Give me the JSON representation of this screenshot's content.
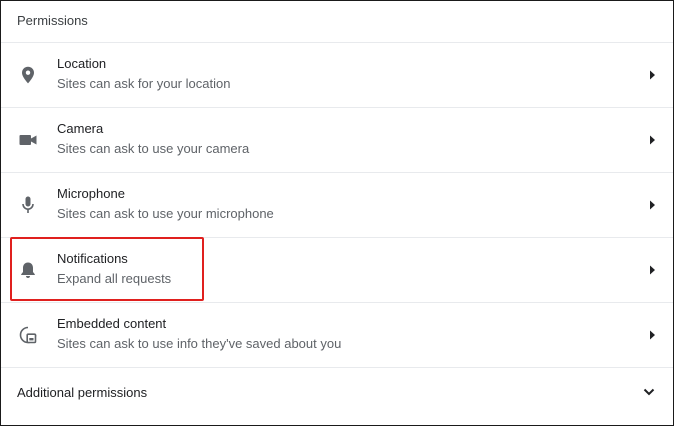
{
  "section": {
    "title": "Permissions"
  },
  "permissions": [
    {
      "label": "Location",
      "sublabel": "Sites can ask for your location",
      "icon": "location-pin-icon"
    },
    {
      "label": "Camera",
      "sublabel": "Sites can ask to use your camera",
      "icon": "camera-icon"
    },
    {
      "label": "Microphone",
      "sublabel": "Sites can ask to use your microphone",
      "icon": "microphone-icon"
    },
    {
      "label": "Notifications",
      "sublabel": "Expand all requests",
      "icon": "bell-icon"
    },
    {
      "label": "Embedded content",
      "sublabel": "Sites can ask to use info they've saved about you",
      "icon": "embedded-content-icon"
    }
  ],
  "additional": {
    "label": "Additional permissions"
  },
  "colors": {
    "highlight": "#e0201e",
    "icon": "#5f6368",
    "divider": "#e8eaed"
  }
}
